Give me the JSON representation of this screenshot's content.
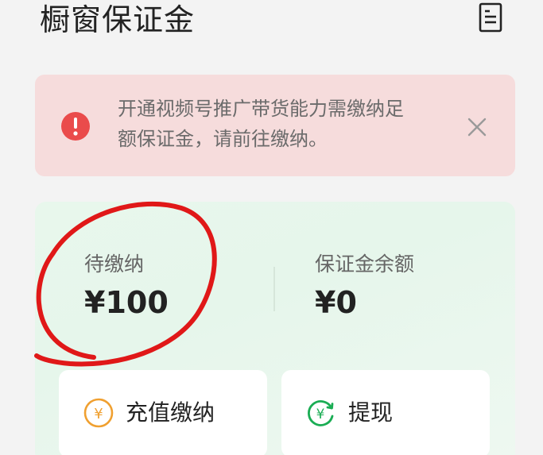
{
  "header": {
    "title": "橱窗保证金",
    "doc_icon": "document-list-icon"
  },
  "alert": {
    "icon": "exclamation-circle-icon",
    "message_line1": "开通视频号推广带货能力需缴纳足",
    "message_line2": "额保证金，请前往缴纳。",
    "close_icon": "close-icon",
    "color": "#e5484d"
  },
  "balance": {
    "pending_label": "待缴纳",
    "pending_value": "¥100",
    "deposit_label": "保证金余额",
    "deposit_value": "¥0"
  },
  "actions": {
    "recharge_label": "充值缴纳",
    "recharge_icon": "yen-circle-icon",
    "withdraw_label": "提现",
    "withdraw_icon": "yen-refresh-icon"
  },
  "colors": {
    "accent_green": "#1aad54",
    "accent_orange": "#f0a030",
    "annotation_red": "#e01818"
  }
}
